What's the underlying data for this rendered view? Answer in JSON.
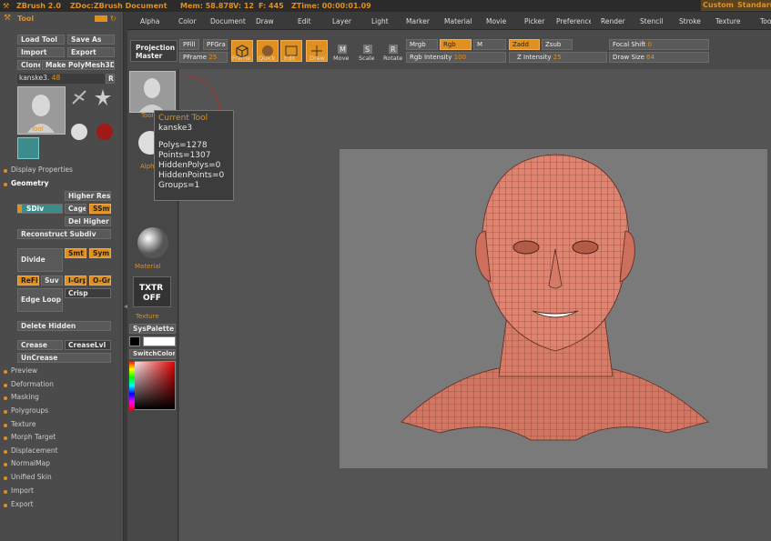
{
  "titlebar": {
    "app": "ZBrush 2.0",
    "doc": "ZDoc:ZBrush Document",
    "mem": "Mem: 58.878",
    "verts": "V: 12",
    "faces": "F: 445",
    "ztime": "ZTime: 00:00:01.09",
    "custom": "Custom",
    "standard": "Standard"
  },
  "menu": [
    "Alpha",
    "Color",
    "Document",
    "Draw",
    "Edit",
    "Layer",
    "Light",
    "Marker",
    "Material",
    "Movie",
    "Picker",
    "Preferences",
    "Render",
    "Stencil",
    "Stroke",
    "Texture",
    "Tool"
  ],
  "top": {
    "projection_master": [
      "Projection",
      "Master"
    ],
    "pfill": "PFill",
    "pfgra": "PFGra",
    "pframe": "PFrame",
    "pframe_val": "25",
    "frame": "Frame",
    "quick": "Quick",
    "edit": "Edit",
    "draw": "Draw",
    "move": "Move",
    "scale": "Scale",
    "rotate": "Rotate",
    "mrgb": "Mrgb",
    "rgb": "Rgb",
    "m": "M",
    "zadd": "Zadd",
    "zsub": "Zsub",
    "rgb_intensity": "Rgb Intensity",
    "rgb_intensity_val": "100",
    "z_intensity": "Z Intensity",
    "z_intensity_val": "25",
    "focal_shift": "Focal Shift",
    "focal_shift_val": "0",
    "draw_size": "Draw Size",
    "draw_size_val": "64"
  },
  "tool": {
    "title": "Tool",
    "load": "Load Tool",
    "save": "Save As",
    "import": "Import",
    "export": "Export",
    "clone": "Clone",
    "polymesh": "Make PolyMesh3D",
    "current": "kanske3.",
    "current_num": "48",
    "r": "R",
    "tool_label": "Tool"
  },
  "sections_top": [
    "Display Properties",
    "Geometry"
  ],
  "geometry": {
    "higher_res": "Higher Res",
    "sdiv": "SDiv",
    "cage": "Cage",
    "ssmt": "SSmt",
    "del_higher": "Del Higher",
    "reconstruct": "Reconstruct Subdiv",
    "divide": "Divide",
    "smt": "Smt",
    "sym": "Sym",
    "refit": "ReFit",
    "suv": "Suv",
    "igrp": "I-Grp",
    "ogrp": "O-Grp",
    "edge_loop": "Edge Loop",
    "crisp": "Crisp",
    "delete_hidden": "Delete Hidden",
    "crease": "Crease",
    "crease_lvl": "CreaseLvl",
    "uncrease": "UnCrease"
  },
  "sections_bottom": [
    "Preview",
    "Deformation",
    "Masking",
    "Polygroups",
    "Texture",
    "Morph Target",
    "Displacement",
    "NormalMap",
    "Unified Skin",
    "Import",
    "Export"
  ],
  "shelf": {
    "tool": "Tool",
    "alpha": "Alpha",
    "material": "Material",
    "txtr": "TXTR",
    "off": "OFF",
    "texture": "Texture",
    "syspalette": "SysPalette",
    "switchcolor": "SwitchColor"
  },
  "tooltip": {
    "title": "Current Tool",
    "name": "kanske3",
    "polys": "Polys=1278",
    "points": "Points=1307",
    "hidden_polys": "HiddenPolys=0",
    "hidden_points": "HiddenPoints=0",
    "groups": "Groups=1"
  },
  "colors": {
    "accent": "#e0901e",
    "panel": "#4b4b4b",
    "canvas": "#7a7a7a",
    "skin": "#d97a66"
  }
}
